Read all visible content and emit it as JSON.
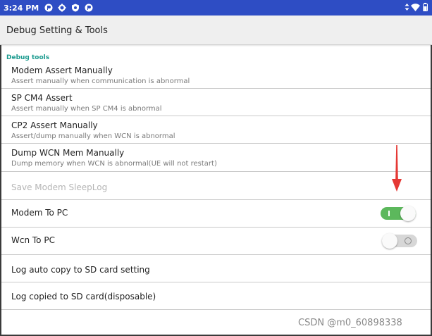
{
  "status_bar": {
    "time": "3:24 PM"
  },
  "toolbar": {
    "title": "Debug Setting & Tools"
  },
  "section": {
    "header": "Debug tools"
  },
  "items": [
    {
      "title": "Modem Assert Manually",
      "summary": "Assert manually when communication is abnormal"
    },
    {
      "title": "SP CM4 Assert",
      "summary": "Assert manually when SP CM4 is abnormal"
    },
    {
      "title": "CP2 Assert Manually",
      "summary": "Assert/dump manually when WCN is abnormal"
    },
    {
      "title": "Dump WCN Mem Manually",
      "summary": "Dump memory when WCN is abnormal(UE will not restart)"
    }
  ],
  "save_modem_sleeplog": {
    "label": "Save Modem SleepLog",
    "enabled": false
  },
  "modem_to_pc": {
    "label": "Modem To PC",
    "enabled": true
  },
  "wcn_to_pc": {
    "label": "Wcn To PC",
    "enabled": false
  },
  "log_auto_copy": {
    "label": "Log auto copy to SD card setting"
  },
  "log_copied": {
    "label": "Log copied to SD card(disposable)"
  },
  "watermark": "CSDN @m0_60898338",
  "colors": {
    "status_bar": "#2e4dc4",
    "accent": "#1b9b8f",
    "switch_on": "#5cb85c",
    "arrow": "#e53935"
  }
}
